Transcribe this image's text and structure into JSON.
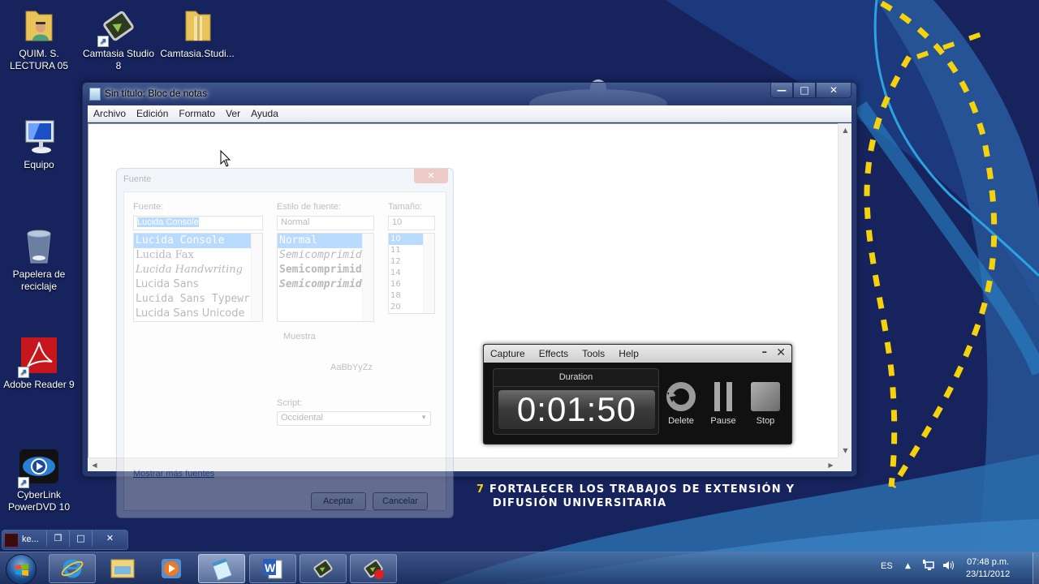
{
  "desktop": {
    "icons": [
      {
        "label": "QUIM. S. LECTURA 05",
        "icon": "user-folder-icon"
      },
      {
        "label": "Camtasia Studio 8",
        "icon": "camtasia-icon"
      },
      {
        "label": "Camtasia.Studi...",
        "icon": "folder-icon"
      },
      {
        "label": "Equipo",
        "icon": "computer-icon"
      },
      {
        "label": "Papelera de reciclaje",
        "icon": "recycle-bin-icon"
      },
      {
        "label": "Adobe Reader 9",
        "icon": "adobe-reader-icon"
      },
      {
        "label": "CyberLink PowerDVD 10",
        "icon": "powerdvd-icon"
      }
    ],
    "wallpaper_caption": {
      "number": "7",
      "line1": "FORTALECER LOS TRABAJOS DE EXTENSIÓN Y",
      "line2": "DIFUSIÓN UNIVERSITARIA"
    },
    "colors": {
      "wallpaper": "#16235c",
      "accent_yellow": "#f5d20c",
      "accent_blue": "#2a86c8"
    }
  },
  "notepad": {
    "title": "Sin título: Bloc de notas",
    "menu": [
      "Archivo",
      "Edición",
      "Formato",
      "Ver",
      "Ayuda"
    ],
    "controls": {
      "minimize": "—",
      "maximize": "□",
      "close": "✕"
    },
    "content": ""
  },
  "font_dialog": {
    "title": "Fuente",
    "close": "✕",
    "font_label": "Fuente:",
    "font_value": "Lucida Console",
    "fonts": [
      "Lucida Console",
      "Lucida Fax",
      "Lucida Handwriting",
      "Lucida Sans",
      "Lucida Sans Typewriter",
      "Lucida Sans Unicode"
    ],
    "style_label": "Estilo de fuente:",
    "style_value": "Normal",
    "styles": [
      "Normal",
      "Semicomprimida",
      "Semicomprimida",
      "Semicomprimida"
    ],
    "size_label": "Tamaño:",
    "size_value": "10",
    "sizes": [
      "10",
      "11",
      "12",
      "14",
      "16",
      "18",
      "20"
    ],
    "sample_label": "Muestra",
    "sample_text": "AaBbYyZz",
    "script_label": "Script:",
    "script_value": "Occidental",
    "more_fonts_link": "Mostrar más fuentes",
    "ok": "Aceptar",
    "cancel": "Cancelar"
  },
  "recorder": {
    "menu": [
      "Capture",
      "Effects",
      "Tools",
      "Help"
    ],
    "minimize": "–",
    "close": "✕",
    "duration_label": "Duration",
    "duration": "0:01:50",
    "buttons": [
      {
        "label": "Delete",
        "icon": "delete-icon"
      },
      {
        "label": "Pause",
        "icon": "pause-icon"
      },
      {
        "label": "Stop",
        "icon": "stop-icon"
      }
    ]
  },
  "mini_window": {
    "title": "ke...",
    "restore": "❐",
    "maximize": "□",
    "close": "✕"
  },
  "taskbar": {
    "apps": [
      {
        "name": "internet-explorer",
        "state": "open"
      },
      {
        "name": "windows-explorer",
        "state": "pinned"
      },
      {
        "name": "windows-media-player",
        "state": "pinned"
      },
      {
        "name": "notepad",
        "state": "active"
      },
      {
        "name": "microsoft-word",
        "state": "open"
      },
      {
        "name": "camtasia-studio",
        "state": "open"
      },
      {
        "name": "camtasia-recorder",
        "state": "open"
      }
    ],
    "language": "ES",
    "tray_arrow": "▲",
    "time": "07:48 p.m.",
    "date": "23/11/2012"
  }
}
